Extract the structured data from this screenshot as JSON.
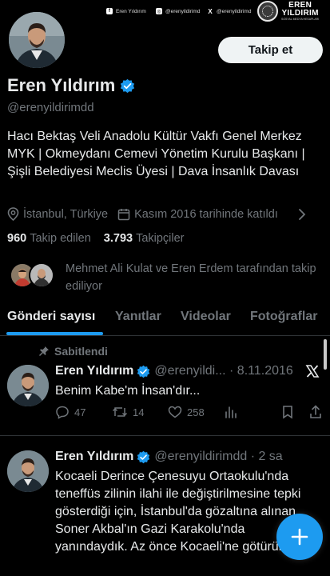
{
  "watermark": {
    "facebook": "Eren Yıldırım",
    "instagram": "@erenyildirimd",
    "x": "@erenyildirimd",
    "brand_line1": "EREN",
    "brand_line2": "YILDIRIM",
    "brand_sub": "SOSYAL MEDYA HESAPLARI"
  },
  "profile": {
    "name": "Eren Yıldırım",
    "handle": "@erenyildirimdd",
    "follow_button": "Takip et",
    "bio": "Hacı Bektaş Veli Anadolu Kültür Vakfı Genel Merkez MYK | Okmeydanı Cemevi Yönetim Kurulu Başkanı | Şişli Belediyesi Meclis Üyesi | Dava İnsanlık Davası",
    "location": "İstanbul, Türkiye",
    "joined": "Kasım 2016 tarihinde katıldı",
    "following_count": "960",
    "following_label": "Takip edilen",
    "followers_count": "3.793",
    "followers_label": "Takipçiler",
    "followed_by": "Mehmet Ali Kulat ve Eren Erdem tarafından takip ediliyor"
  },
  "tabs": [
    "Gönderi sayısı",
    "Yanıtlar",
    "Videolar",
    "Fotoğraflar"
  ],
  "posts": [
    {
      "pinned_label": "Sabitlendi",
      "name": "Eren Yıldırım",
      "meta": "@erenyildi... · 8.11.2016",
      "text": "Benim Kabe'm İnsan'dır...",
      "replies": "47",
      "reposts": "14",
      "likes": "258"
    },
    {
      "name": "Eren Yıldırım",
      "meta": "@erenyildirimdd · 2 sa",
      "text": "Kocaeli Derince Çenesuyu Ortaokulu'nda teneffüs zilinin ilahi ile değiştirilmesine tepki gösterdiği için, İstanbul'da gözaltına alınan Soner Akbal'ın Gazi Karakolu'nda yanındaydık. Az önce  Kocaeli'ne götürüldü"
    }
  ],
  "colors": {
    "background": "#000000",
    "accent": "#1d9bf0",
    "text_primary": "#e7e9ea",
    "text_secondary": "#71767b",
    "divider": "#2f3336"
  },
  "icons": [
    "facebook-icon",
    "instagram-icon",
    "x-icon",
    "verified-badge-icon",
    "location-icon",
    "calendar-icon",
    "chevron-right-icon",
    "pin-icon",
    "reply-icon",
    "repost-icon",
    "like-icon",
    "views-icon",
    "bookmark-icon",
    "share-icon",
    "x-logo-icon",
    "plus-icon"
  ]
}
